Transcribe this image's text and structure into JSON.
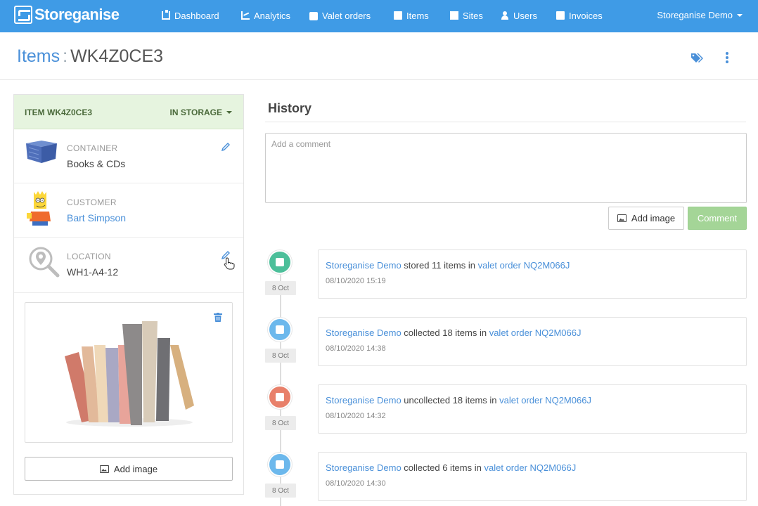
{
  "brand": {
    "name": "Storeganise"
  },
  "nav": {
    "items": [
      {
        "label": "Dashboard",
        "icon": "sitemap-icon"
      },
      {
        "label": "Analytics",
        "icon": "chart-icon"
      },
      {
        "label": "Valet orders",
        "icon": "truck-icon"
      },
      {
        "label": "Items",
        "icon": "box-icon"
      },
      {
        "label": "Sites",
        "icon": "building-icon"
      },
      {
        "label": "Users",
        "icon": "user-icon"
      },
      {
        "label": "Invoices",
        "icon": "file-icon"
      }
    ],
    "account": "Storeganise Demo"
  },
  "header": {
    "section": "Items",
    "separator": ":",
    "item_code": "WK4Z0CE3"
  },
  "item": {
    "title": "ITEM WK4Z0CE3",
    "status": "IN STORAGE",
    "container": {
      "label": "CONTAINER",
      "value": "Books & CDs"
    },
    "customer": {
      "label": "CUSTOMER",
      "value": "Bart Simpson"
    },
    "location": {
      "label": "LOCATION",
      "value": "WH1-A4-12"
    },
    "add_image": "Add image"
  },
  "history": {
    "title": "History",
    "comment_placeholder": "Add a comment",
    "add_image": "Add image",
    "comment_button": "Comment",
    "events": [
      {
        "actor": "Storeganise Demo",
        "action": "stored 11 items in",
        "order": "valet order NQ2M066J",
        "time": "08/10/2020 15:19",
        "date": "8 Oct",
        "color": "#4cbf9a"
      },
      {
        "actor": "Storeganise Demo",
        "action": "collected 18 items in",
        "order": "valet order NQ2M066J",
        "time": "08/10/2020 14:38",
        "date": "8 Oct",
        "color": "#6cb8ec"
      },
      {
        "actor": "Storeganise Demo",
        "action": "uncollected 18 items in",
        "order": "valet order NQ2M066J",
        "time": "08/10/2020 14:32",
        "date": "8 Oct",
        "color": "#e8806a"
      },
      {
        "actor": "Storeganise Demo",
        "action": "collected 6 items in",
        "order": "valet order NQ2M066J",
        "time": "08/10/2020 14:30",
        "date": "8 Oct",
        "color": "#6cb8ec"
      }
    ]
  },
  "colors": {
    "navbar": "#3f9be6",
    "link": "#4a90d9",
    "status_bg": "#e6f4df",
    "comment_btn": "#a4d597"
  }
}
